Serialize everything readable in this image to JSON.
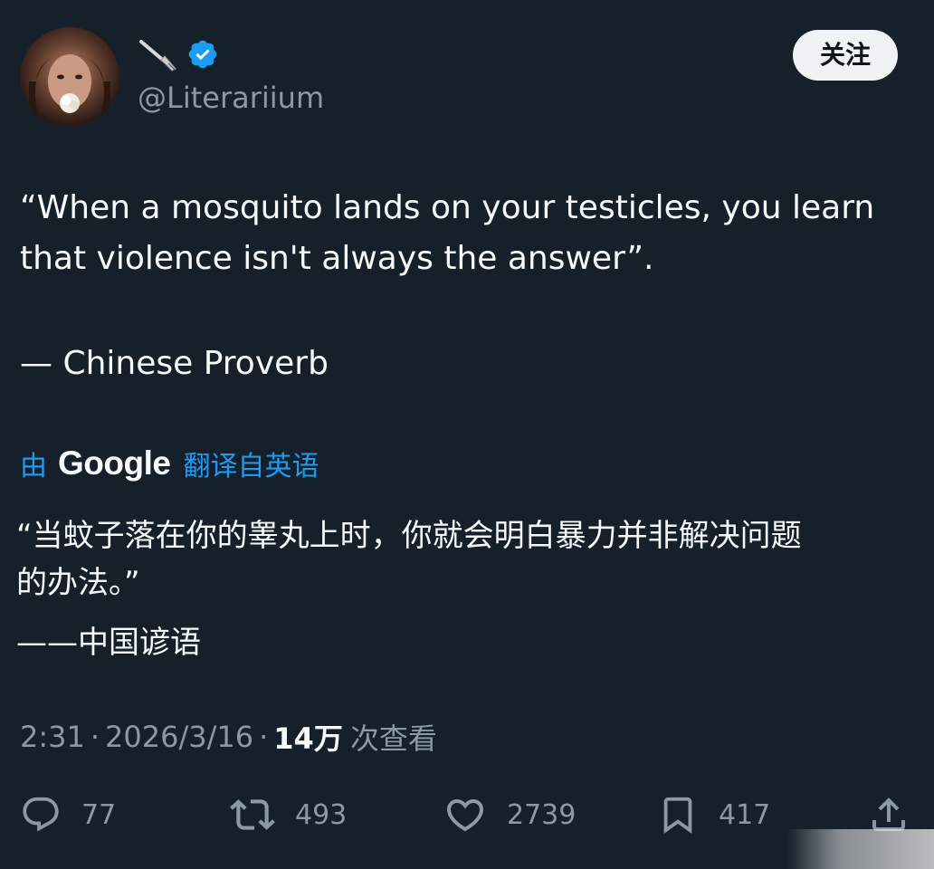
{
  "user": {
    "display_name_icon": "fountain-pen-icon",
    "verified_icon": "verified-badge-icon",
    "handle": "@Literariium"
  },
  "follow_button": {
    "label": "关注"
  },
  "tweet": {
    "lines": [
      "“When a mosquito lands on your testicles, you learn",
      "that violence isn't always the answer”.",
      "— Chinese Proverb"
    ]
  },
  "translation": {
    "by": "由",
    "provider": "Google",
    "label": "翻译自英语",
    "lines": [
      "“当蚊子落在你的睾丸上时，你就会明白暴力并非解决问题",
      "的办法。”",
      "——中国谚语"
    ]
  },
  "meta": {
    "time": "2:31",
    "separator": "·",
    "date": "2026/3/16",
    "views_count": "14万",
    "views_label": "次查看"
  },
  "actions": {
    "replies": {
      "icon": "reply-icon",
      "count": "77"
    },
    "reposts": {
      "icon": "repost-icon",
      "count": "493"
    },
    "likes": {
      "icon": "heart-icon",
      "count": "2739"
    },
    "bookmarks": {
      "icon": "bookmark-icon",
      "count": "417"
    },
    "share": {
      "icon": "share-icon"
    }
  },
  "colors": {
    "background": "#15202b",
    "text": "#f7f9f9",
    "secondary_text": "#8b98a5",
    "accent": "#1d9bf0",
    "button_bg": "#eff3f4"
  }
}
